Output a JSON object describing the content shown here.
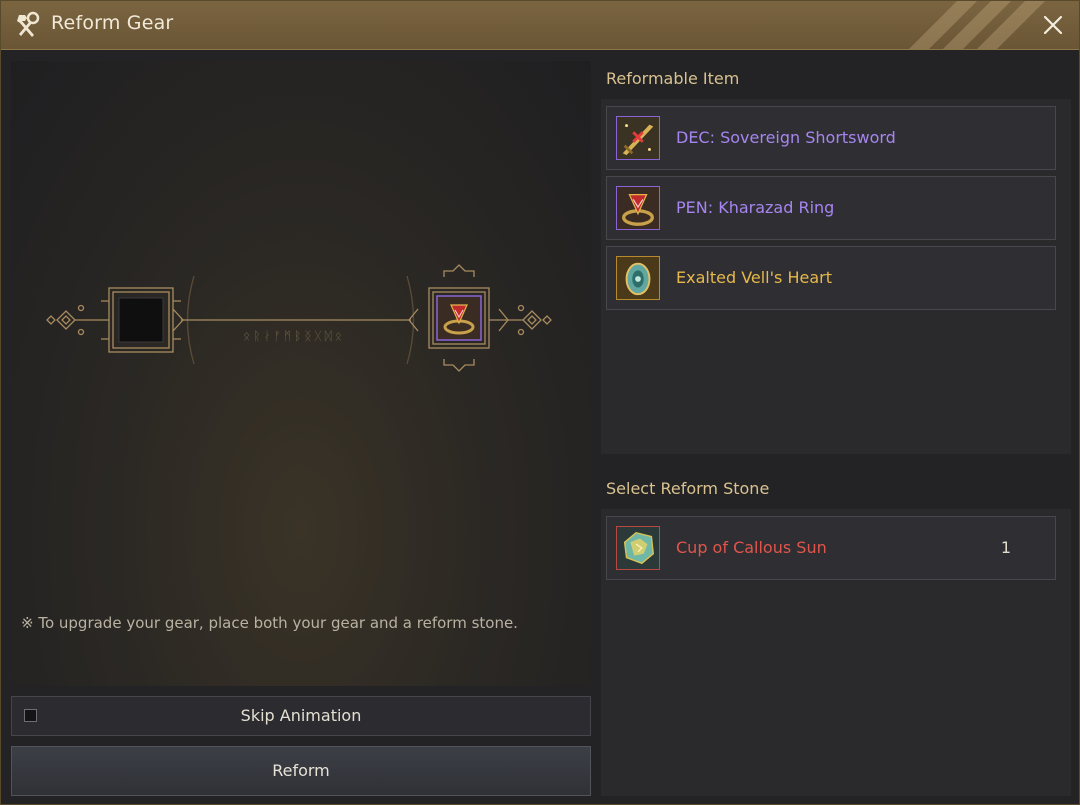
{
  "window": {
    "title": "Reform Gear",
    "icons": {
      "title": "hammer-wrench-icon",
      "close": "close-icon"
    }
  },
  "left": {
    "rune_text": "ᛟᚱᛅᚠᛗᛒᛝᚷᛞᛟ",
    "hint": "※ To upgrade your gear, place both your gear and a reform stone.",
    "skip_animation_label": "Skip Animation",
    "skip_animation_checked": false,
    "reform_label": "Reform"
  },
  "reformable": {
    "title": "Reformable Item",
    "items": [
      {
        "name": "DEC: Sovereign Shortsword",
        "color": "#a685f0",
        "border": "#8c64d8",
        "icon": "shortsword-icon"
      },
      {
        "name": "PEN: Kharazad Ring",
        "color": "#a685f0",
        "border": "#8c64d8",
        "icon": "ring-icon"
      },
      {
        "name": "Exalted Vell's Heart",
        "color": "#e7b84a",
        "border": "#b8892d",
        "icon": "heart-gem-icon"
      }
    ]
  },
  "stones": {
    "title": "Select Reform Stone",
    "items": [
      {
        "name": "Cup of Callous Sun",
        "quantity": "1",
        "color": "#e0554b",
        "border": "#b84a3d",
        "icon": "sun-cup-stone-icon"
      }
    ]
  },
  "colors": {
    "title_bar": "#74603e",
    "accent_gold": "#c8a86a"
  }
}
